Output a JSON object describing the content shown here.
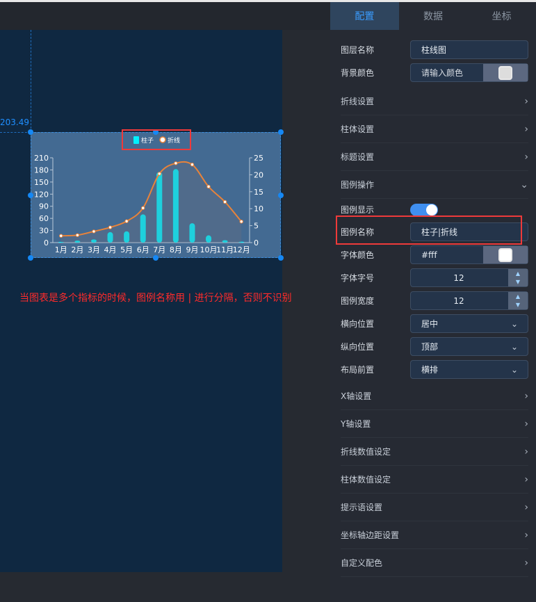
{
  "canvas": {
    "coord_label": "203.49",
    "note": "当图表是多个指标的时候，图例名称用 | 进行分隔，否则不识别"
  },
  "panel": {
    "tabs": [
      {
        "label": "配置",
        "active": true
      },
      {
        "label": "数据"
      },
      {
        "label": "坐标"
      }
    ],
    "layer_name": {
      "label": "图层名称",
      "value": "柱线图"
    },
    "bg_color": {
      "label": "背景颜色",
      "placeholder": "请输入颜色"
    },
    "sections_top": [
      "折线设置",
      "柱体设置",
      "标题设置",
      "图例操作"
    ],
    "legend_show": {
      "label": "图例显示",
      "on": true
    },
    "legend_name": {
      "label": "图例名称",
      "value": "柱子|折线"
    },
    "font_color": {
      "label": "字体颜色",
      "value": "#fff"
    },
    "font_size": {
      "label": "字体字号",
      "value": "12"
    },
    "legend_width": {
      "label": "图例宽度",
      "value": "12"
    },
    "h_pos": {
      "label": "横向位置",
      "value": "居中"
    },
    "v_pos": {
      "label": "纵向位置",
      "value": "顶部"
    },
    "layout": {
      "label": "布局前置",
      "value": "横排"
    },
    "sections_bottom": [
      "X轴设置",
      "Y轴设置",
      "折线数值设定",
      "柱体数值设定",
      "提示语设置",
      "坐标轴边距设置",
      "自定义配色"
    ]
  },
  "chart_data": {
    "type": "bar+line",
    "categories": [
      "1月",
      "2月",
      "3月",
      "4月",
      "5月",
      "6月",
      "7月",
      "8月",
      "9月",
      "10月",
      "11月",
      "12月"
    ],
    "legend": [
      "柱子",
      "折线"
    ],
    "legend_position": "top-center",
    "series": [
      {
        "name": "柱子",
        "type": "bar",
        "axis": "left",
        "color": "#00f0ff",
        "values": [
          2,
          5,
          8,
          26,
          28,
          70,
          175,
          182,
          48,
          18,
          6,
          2.3
        ]
      },
      {
        "name": "折线",
        "type": "line",
        "axis": "right",
        "color": "#e8833a",
        "values": [
          2.0,
          2.2,
          3.3,
          4.5,
          6.3,
          10.2,
          20.3,
          23.4,
          23.0,
          16.5,
          12.0,
          6.2
        ]
      }
    ],
    "y_left": {
      "ylim": [
        0,
        210
      ],
      "ticks": [
        "0",
        "30",
        "60",
        "90",
        "120",
        "150",
        "180",
        "210"
      ]
    },
    "y_right": {
      "ylim": [
        0,
        25
      ],
      "ticks": [
        "0",
        "5",
        "10",
        "15",
        "20",
        "25"
      ]
    },
    "grid": false
  }
}
